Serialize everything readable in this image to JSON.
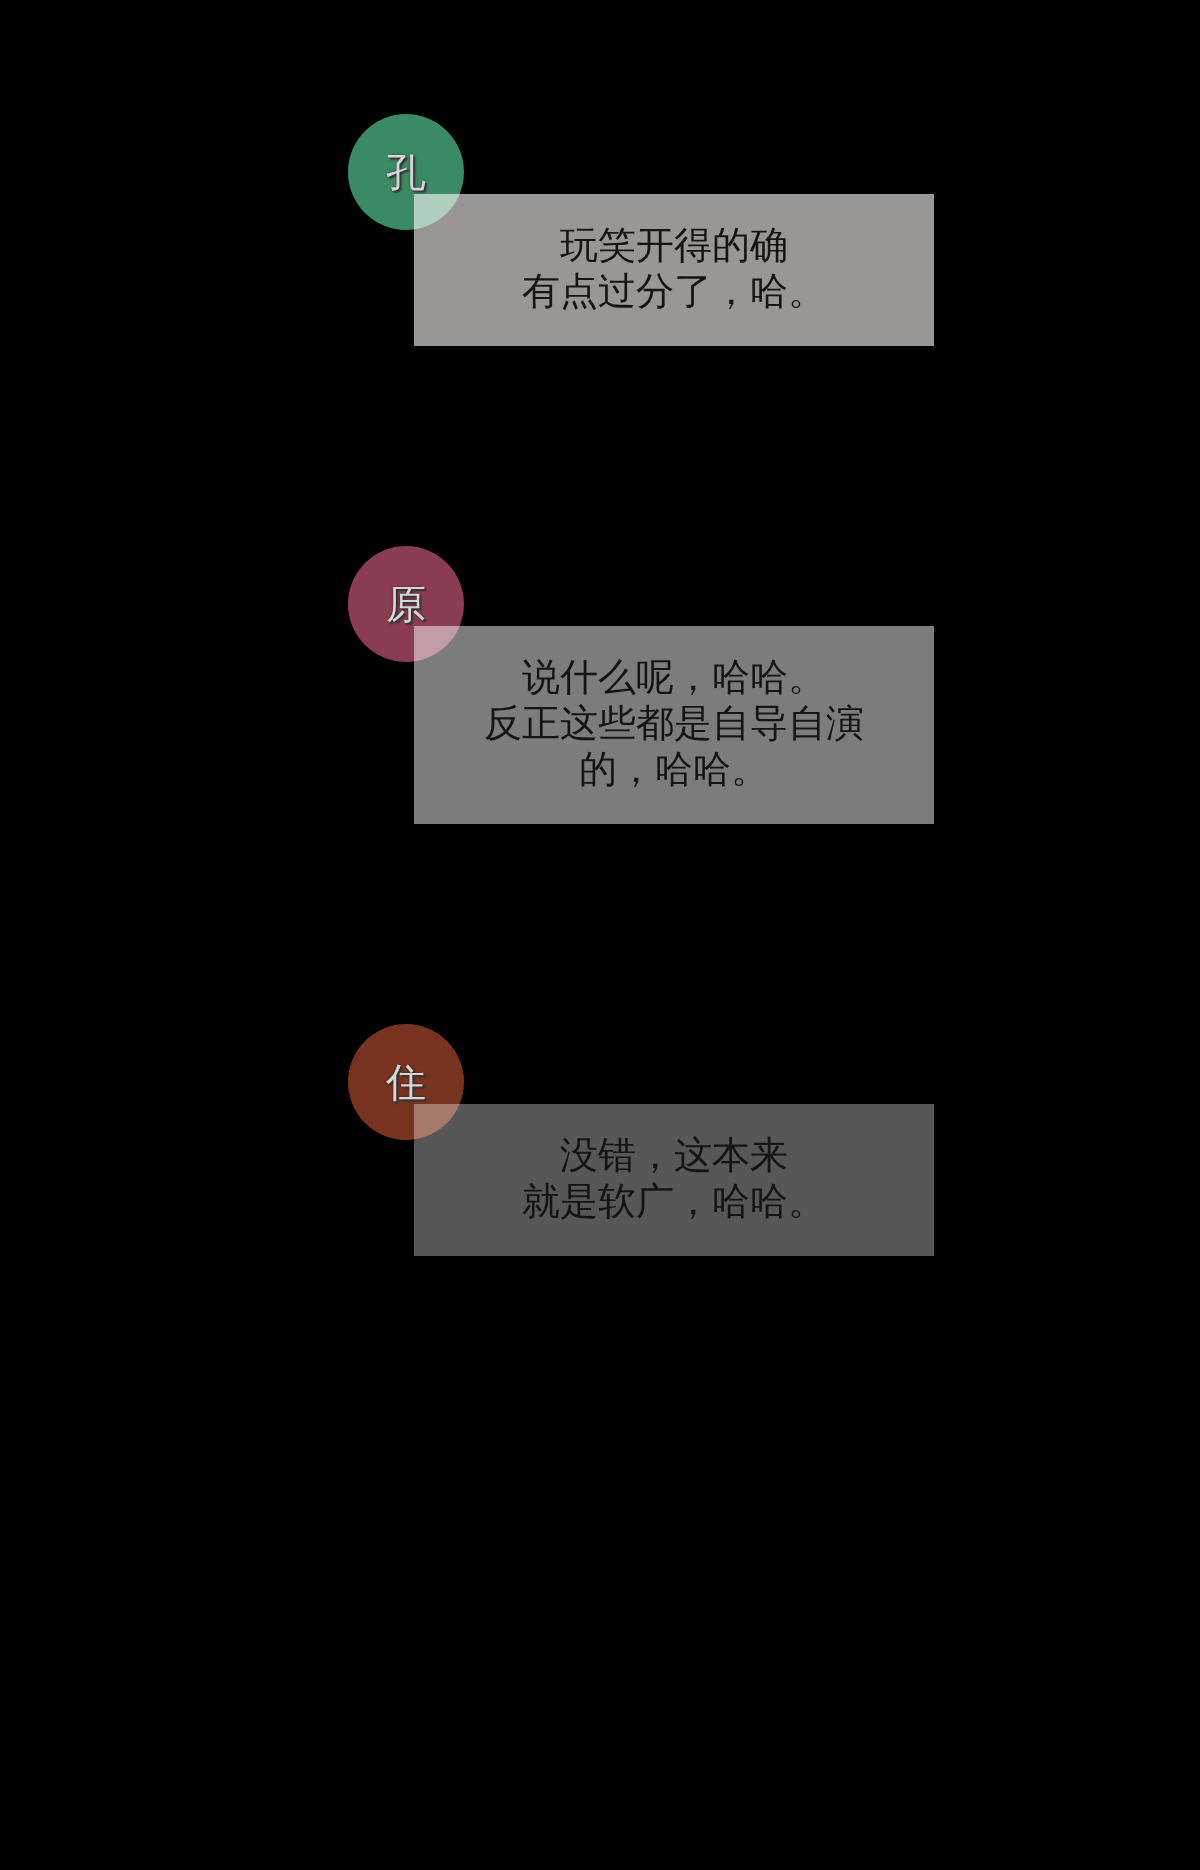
{
  "messages": [
    {
      "avatar": {
        "text": "孔",
        "color": "#3b8a66"
      },
      "bubble": {
        "lines": [
          "玩笑开得的确",
          "有点过分了，哈。"
        ],
        "color": "#999795"
      }
    },
    {
      "avatar": {
        "text": "原",
        "color": "#8a3c52"
      },
      "bubble": {
        "lines": [
          "说什么呢，哈哈。",
          "反正这些都是自导自演",
          "的，哈哈。"
        ],
        "color": "#7c7c7c"
      }
    },
    {
      "avatar": {
        "text": "住",
        "color": "#77331f"
      },
      "bubble": {
        "lines": [
          "没错，这本来",
          "就是软广，哈哈。"
        ],
        "color": "#575757"
      }
    }
  ]
}
